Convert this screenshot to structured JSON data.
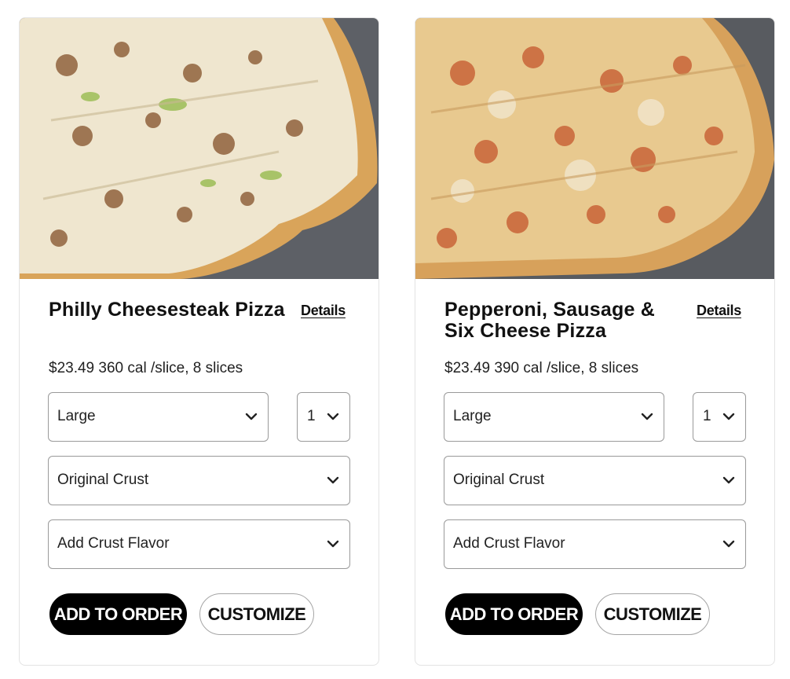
{
  "products": [
    {
      "title": "Philly Cheesesteak Pizza",
      "details_label": "Details",
      "price": "$23.49",
      "calories": "360 cal /slice, 8 slices",
      "size": "Large",
      "quantity": "1",
      "crust": "Original Crust",
      "crust_flavor": "Add Crust Flavor",
      "add_label": "ADD TO ORDER",
      "customize_label": "CUSTOMIZE"
    },
    {
      "title": "Pepperoni, Sausage & Six Cheese Pizza",
      "details_label": "Details",
      "price": "$23.49",
      "calories": "390 cal /slice, 8 slices",
      "size": "Large",
      "quantity": "1",
      "crust": "Original Crust",
      "crust_flavor": "Add Crust Flavor",
      "add_label": "ADD TO ORDER",
      "customize_label": "CUSTOMIZE"
    }
  ],
  "icons": {
    "select_arrow": "chevron-down-icon"
  },
  "colors": {
    "button_primary": "#000000",
    "border": "#9a9a9a",
    "text": "#111111"
  }
}
